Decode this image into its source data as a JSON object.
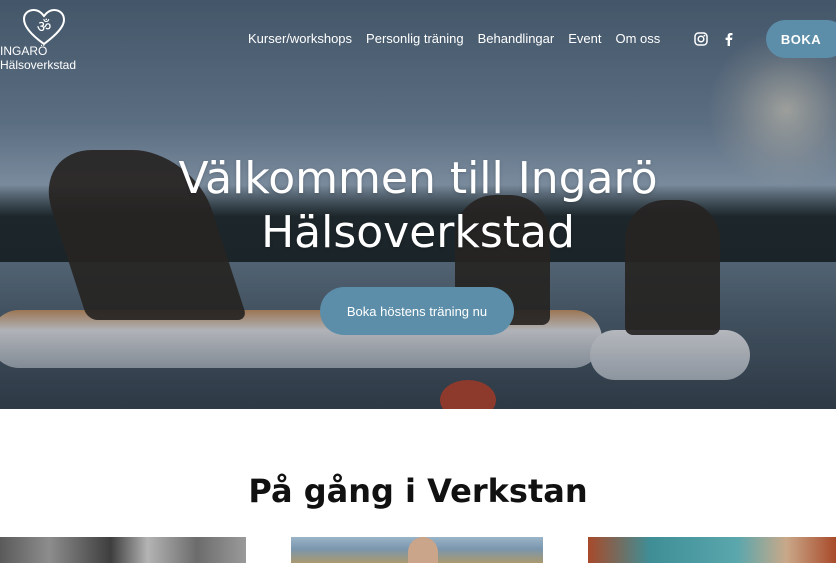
{
  "header": {
    "logo_text_line1": "INGARÖ",
    "logo_text_line2": "Hälsoverkstad",
    "nav": [
      {
        "label": "Kurser/workshops"
      },
      {
        "label": "Personlig träning"
      },
      {
        "label": "Behandlingar"
      },
      {
        "label": "Event"
      },
      {
        "label": "Om oss"
      }
    ],
    "social_icons": [
      "instagram-icon",
      "facebook-icon"
    ],
    "cta_label": "BOKA"
  },
  "hero": {
    "title": "Välkommen till Ingarö Hälsoverkstad",
    "button_label": "Boka höstens träning nu"
  },
  "section": {
    "title": "På gång i Verkstan"
  },
  "colors": {
    "accent": "#5c8ea9",
    "text_dark": "#111111",
    "text_light": "#ffffff"
  }
}
